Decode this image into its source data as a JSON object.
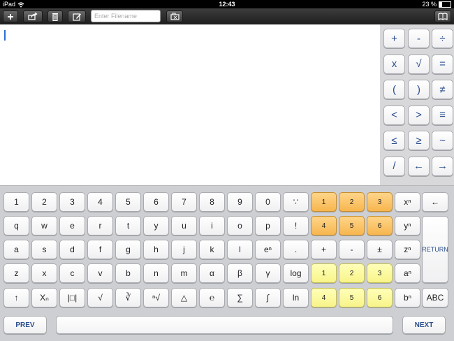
{
  "status_bar": {
    "device": "iPad",
    "time": "12:43",
    "battery_label": "23 %",
    "battery_level": 0.23
  },
  "toolbar": {
    "filename_placeholder": "Enter Filename",
    "icons": [
      "plus-icon",
      "share-icon",
      "trash-icon",
      "edit-icon",
      "folder-icon",
      "book-icon"
    ]
  },
  "editor": {
    "text": ""
  },
  "side_symbols": [
    [
      "+",
      "-",
      "÷"
    ],
    [
      "x",
      "√",
      "="
    ],
    [
      "(",
      ")",
      "≠"
    ],
    [
      "<",
      ">",
      "≡"
    ],
    [
      "≤",
      "≥",
      "~"
    ],
    [
      "/",
      "←",
      "→"
    ]
  ],
  "keyboard": {
    "rows": [
      [
        "1",
        "2",
        "3",
        "4",
        "5",
        "6",
        "7",
        "8",
        "9",
        "0",
        "∵",
        "1",
        "2",
        "3",
        "xⁿ",
        "←"
      ],
      [
        "q",
        "w",
        "e",
        "r",
        "t",
        "y",
        "u",
        "i",
        "o",
        "p",
        "!",
        "4",
        "5",
        "6",
        "yⁿ",
        "RETURN"
      ],
      [
        "a",
        "s",
        "d",
        "f",
        "g",
        "h",
        "j",
        "k",
        "l",
        "eⁿ",
        ".",
        "+",
        "-",
        "±",
        "zⁿ"
      ],
      [
        "z",
        "x",
        "c",
        "v",
        "b",
        "n",
        "m",
        "α",
        "β",
        "γ",
        "log",
        "1",
        "2",
        "3",
        "aⁿ"
      ],
      [
        "↑",
        "Xₙ",
        "|□|",
        "√",
        "∛",
        "ⁿ√",
        "△",
        "℮",
        "∑",
        "∫",
        "ln",
        "4",
        "5",
        "6",
        "bⁿ",
        "ABC"
      ]
    ],
    "prev_label": "PREV",
    "next_label": "NEXT"
  },
  "colors": {
    "orange_keys": "#f7b64e",
    "yellow_keys": "#f8f48a",
    "accent_text": "#2c4f8f",
    "cursor": "#2a6fd6"
  }
}
